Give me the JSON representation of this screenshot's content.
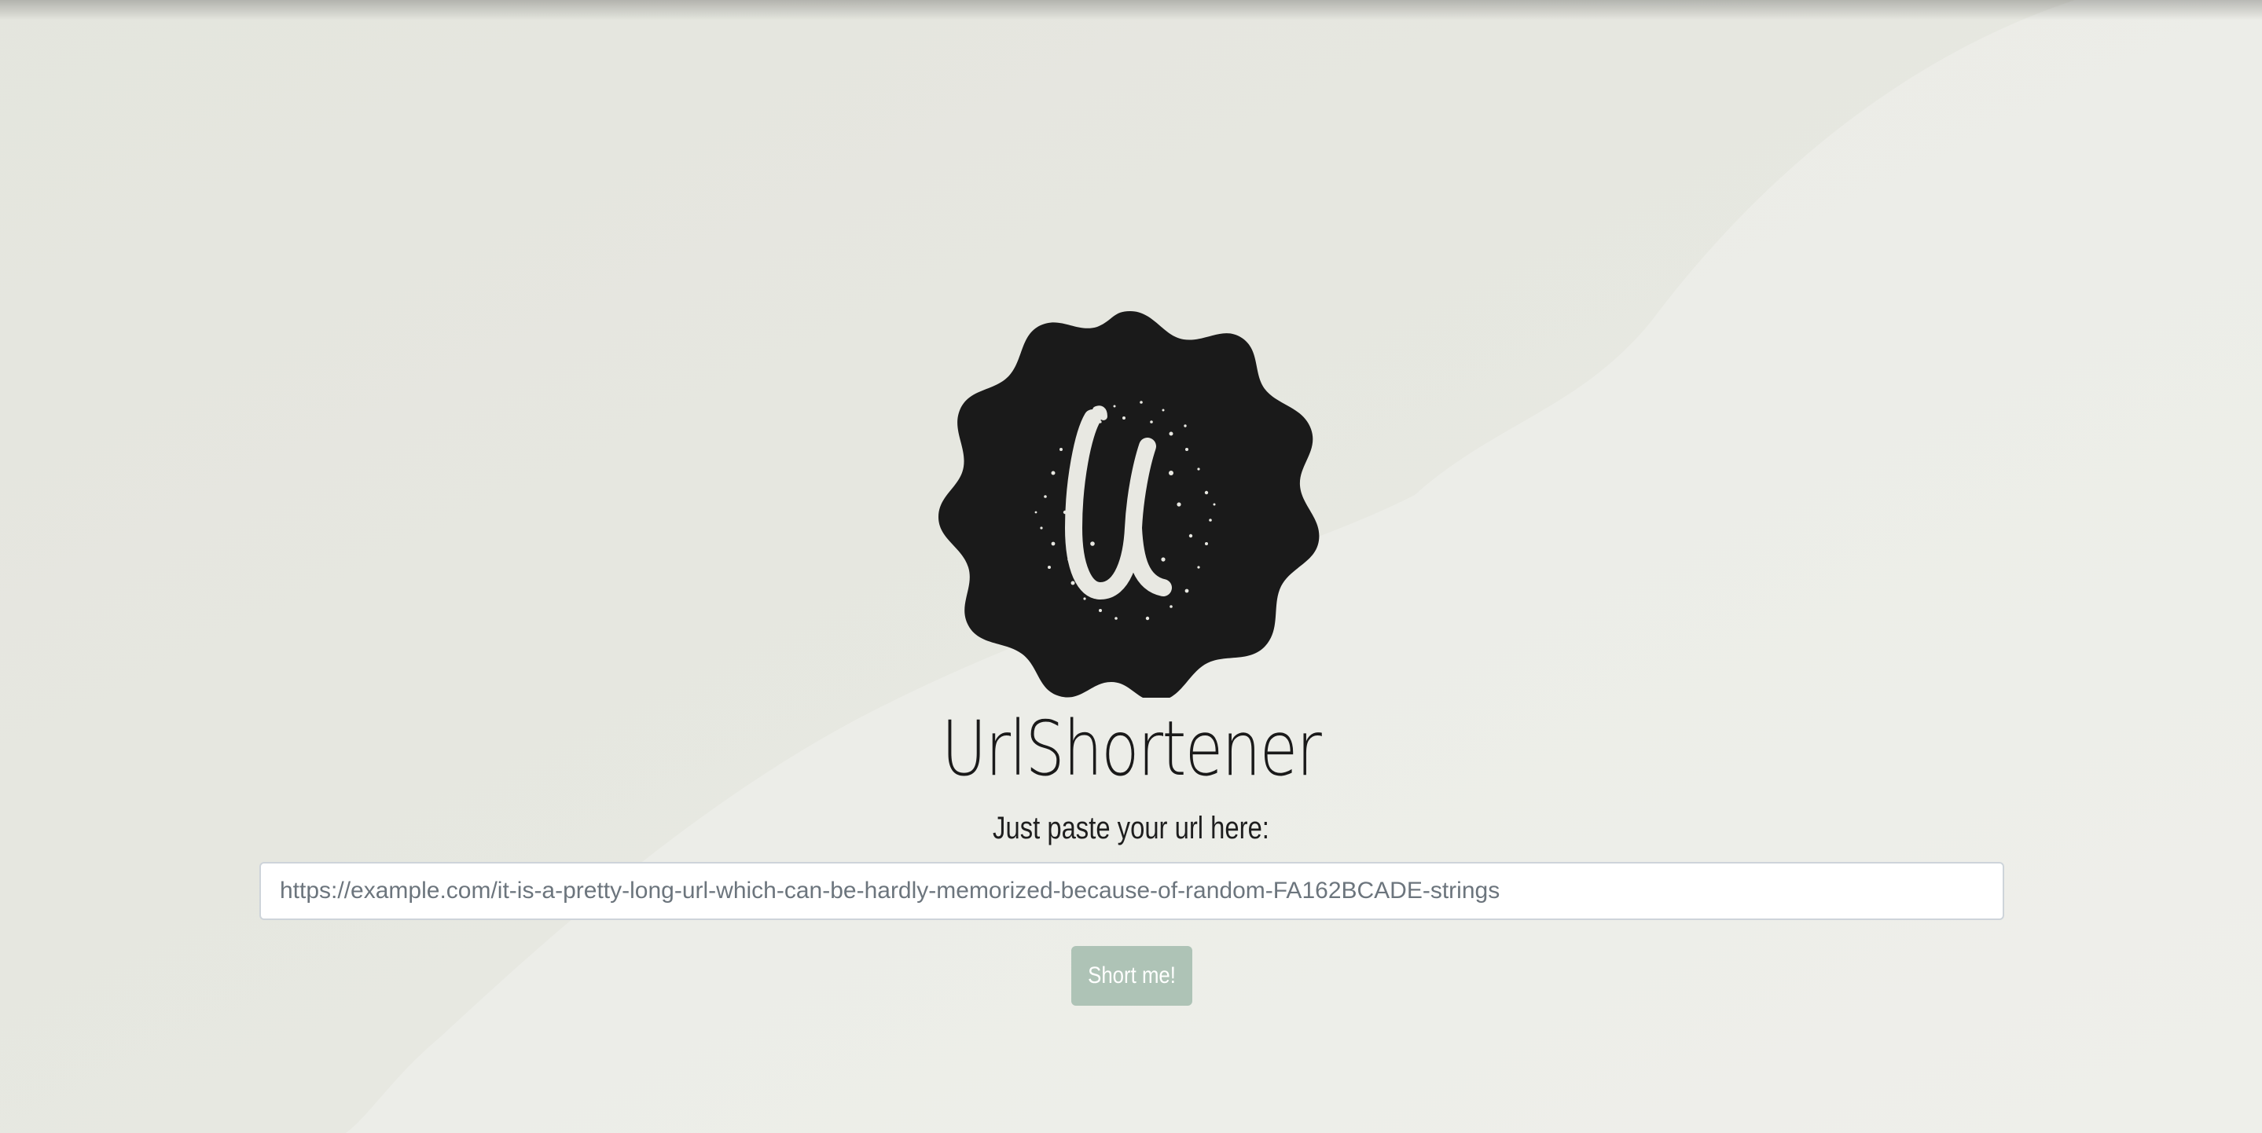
{
  "app": {
    "title": "UrlShortener",
    "logo_letter": "U",
    "logo_icon": "badge-logo-icon"
  },
  "form": {
    "prompt": "Just paste your url here:",
    "input_placeholder": "https://example.com/it-is-a-pretty-long-url-which-can-be-hardly-memorized-because-of-random-FA162BCADE-strings",
    "input_value": "",
    "submit_label": "Short me!",
    "submit_disabled": true
  },
  "colors": {
    "background": "#e7e8e1",
    "background_wave": "#edeee9",
    "logo_badge": "#1a1a1a",
    "logo_letter": "#e8e8e2",
    "button": "#aec3b6"
  }
}
